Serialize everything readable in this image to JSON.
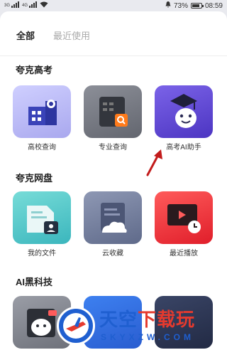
{
  "status_bar": {
    "carrier1": "3G",
    "carrier2": "4G",
    "battery_percent": "73%",
    "time": "08:59"
  },
  "tabs": [
    {
      "label": "全部",
      "active": true
    },
    {
      "label": "最近使用",
      "active": false
    }
  ],
  "sections": [
    {
      "title": "夸克高考",
      "items": [
        {
          "label": "高校查询",
          "icon": "school-building-icon"
        },
        {
          "label": "专业查询",
          "icon": "major-search-icon"
        },
        {
          "label": "高考AI助手",
          "icon": "graduation-cap-robot-icon"
        }
      ]
    },
    {
      "title": "夸克网盘",
      "items": [
        {
          "label": "我的文件",
          "icon": "my-files-icon"
        },
        {
          "label": "云收藏",
          "icon": "cloud-favorite-icon"
        },
        {
          "label": "最近播放",
          "icon": "recent-play-icon"
        }
      ]
    },
    {
      "title": "AI黑科技",
      "items": [
        {
          "label": "",
          "icon": "ai-robot-icon"
        },
        {
          "label": "",
          "icon": "ai-blue-icon"
        },
        {
          "label": "",
          "icon": "ai-dark-icon"
        }
      ]
    }
  ],
  "watermark": {
    "title_part1": "天空",
    "title_part2": "下载玩",
    "subtitle": "SKYXZW.COM"
  },
  "colors": {
    "accent_red": "#e53a2e",
    "accent_blue": "#1f5fd0",
    "purple": "#5b44d6"
  }
}
